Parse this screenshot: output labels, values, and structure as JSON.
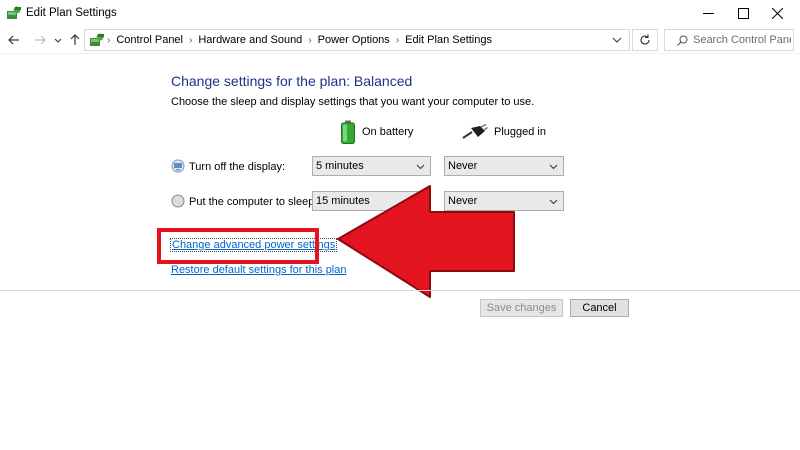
{
  "window": {
    "title": "Edit Plan Settings"
  },
  "address": {
    "breadcrumbs": [
      "Control Panel",
      "Hardware and Sound",
      "Power Options",
      "Edit Plan Settings"
    ],
    "search_placeholder": "Search Control Panel"
  },
  "plan": {
    "heading": "Change settings for the plan: Balanced",
    "subheading": "Choose the sleep and display settings that you want your computer to use.",
    "columns": {
      "on_battery": "On battery",
      "plugged_in": "Plugged in"
    },
    "rows": [
      {
        "label": "Turn off the display:",
        "on_battery": "5 minutes",
        "plugged_in": "Never"
      },
      {
        "label": "Put the computer to sleep:",
        "on_battery": "15 minutes",
        "plugged_in": "Never"
      }
    ],
    "links": {
      "advanced": "Change advanced power settings",
      "restore": "Restore default settings for this plan"
    }
  },
  "buttons": {
    "save": "Save changes",
    "cancel": "Cancel"
  },
  "colors": {
    "heading": "#1e3287",
    "link": "#0066cc",
    "highlight": "#e3141f"
  }
}
